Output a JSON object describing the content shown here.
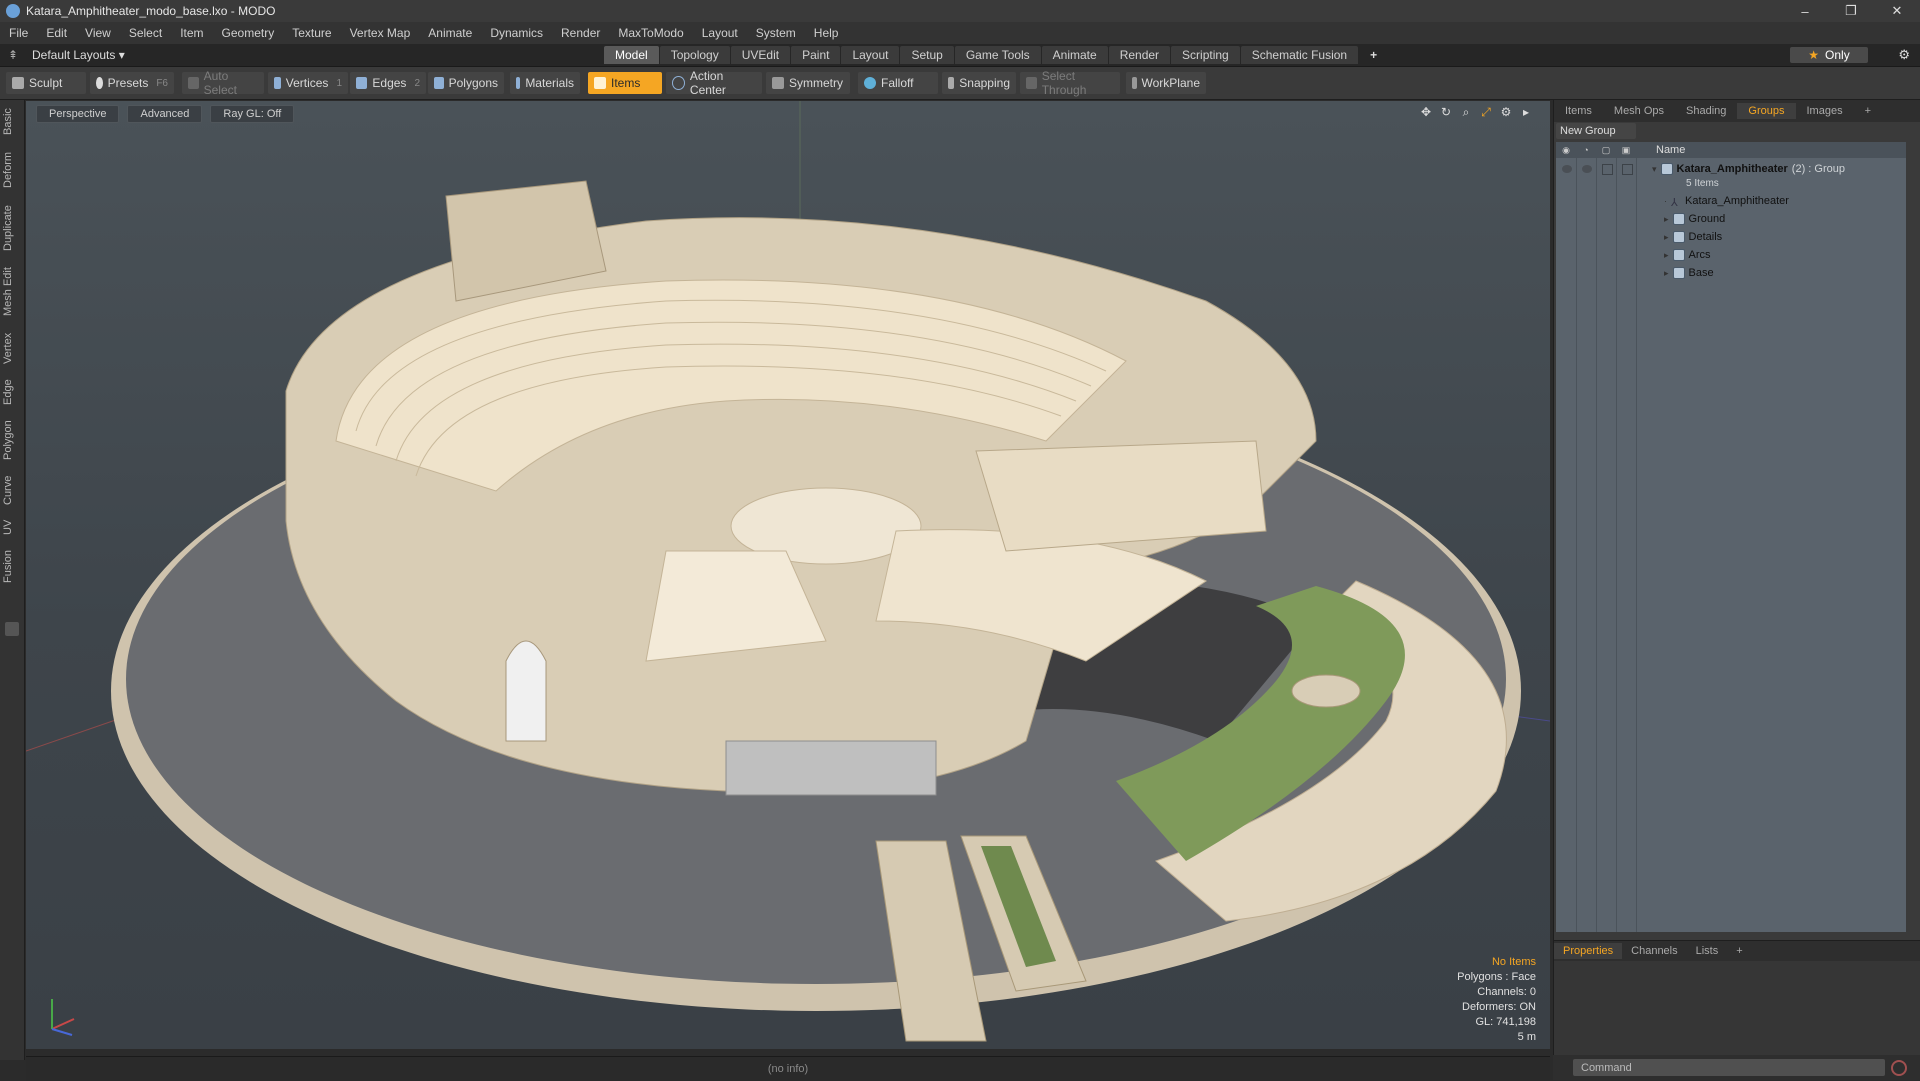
{
  "window": {
    "title": "Katara_Amphitheater_modo_base.lxo - MODO",
    "controls": [
      "–",
      "❐",
      "✕"
    ]
  },
  "menu": [
    "File",
    "Edit",
    "View",
    "Select",
    "Item",
    "Geometry",
    "Texture",
    "Vertex Map",
    "Animate",
    "Dynamics",
    "Render",
    "MaxToModo",
    "Layout",
    "System",
    "Help"
  ],
  "layouts": {
    "label": "Default Layouts ▾"
  },
  "mode_tabs": [
    {
      "label": "Model",
      "active": true
    },
    {
      "label": "Topology"
    },
    {
      "label": "UVEdit"
    },
    {
      "label": "Paint"
    },
    {
      "label": "Layout"
    },
    {
      "label": "Setup"
    },
    {
      "label": "Game Tools"
    },
    {
      "label": "Animate"
    },
    {
      "label": "Render"
    },
    {
      "label": "Scripting"
    },
    {
      "label": "Schematic Fusion"
    }
  ],
  "only_label": "Only",
  "toolbar": {
    "sculpt": "Sculpt",
    "presets": "Presets",
    "presets_key": "F6",
    "auto_select": "Auto Select",
    "vertices": "Vertices",
    "vertices_count": "1",
    "edges": "Edges",
    "edges_count": "2",
    "polygons": "Polygons",
    "materials": "Materials",
    "items": "Items",
    "action_center": "Action Center",
    "symmetry": "Symmetry",
    "falloff": "Falloff",
    "snapping": "Snapping",
    "select_through": "Select Through",
    "workplane": "WorkPlane"
  },
  "left_tabs": [
    "Basic",
    "Deform",
    "Duplicate",
    "Mesh Edit",
    "Vertex",
    "Edge",
    "Polygon",
    "Curve",
    "UV",
    "Fusion"
  ],
  "viewport": {
    "view": "Perspective",
    "shading": "Advanced",
    "raygl": "Ray GL: Off",
    "info": {
      "selection": "No Items",
      "polygons": "Polygons : Face",
      "channels": "Channels: 0",
      "deformers": "Deformers: ON",
      "gl": "GL: 741,198",
      "scale": "5 m"
    }
  },
  "status": "(no info)",
  "right_tabs": [
    {
      "label": "Items"
    },
    {
      "label": "Mesh Ops"
    },
    {
      "label": "Shading"
    },
    {
      "label": "Groups",
      "active": true
    },
    {
      "label": "Images"
    }
  ],
  "groups": {
    "new_group": "New Group",
    "name_col": "Name",
    "group_name": "Katara_Amphitheater",
    "group_suffix": "(2) : Group",
    "group_count": "5 Items",
    "items": [
      "Katara_Amphitheater",
      "Ground",
      "Details",
      "Arcs",
      "Base"
    ]
  },
  "bottom_tabs": [
    {
      "label": "Properties",
      "active": true
    },
    {
      "label": "Channels"
    },
    {
      "label": "Lists"
    }
  ],
  "command": {
    "placeholder": "Command"
  },
  "colors": {
    "accent": "#f5a623",
    "panel": "#3a3a3a",
    "list_bg": "#5a636c"
  }
}
